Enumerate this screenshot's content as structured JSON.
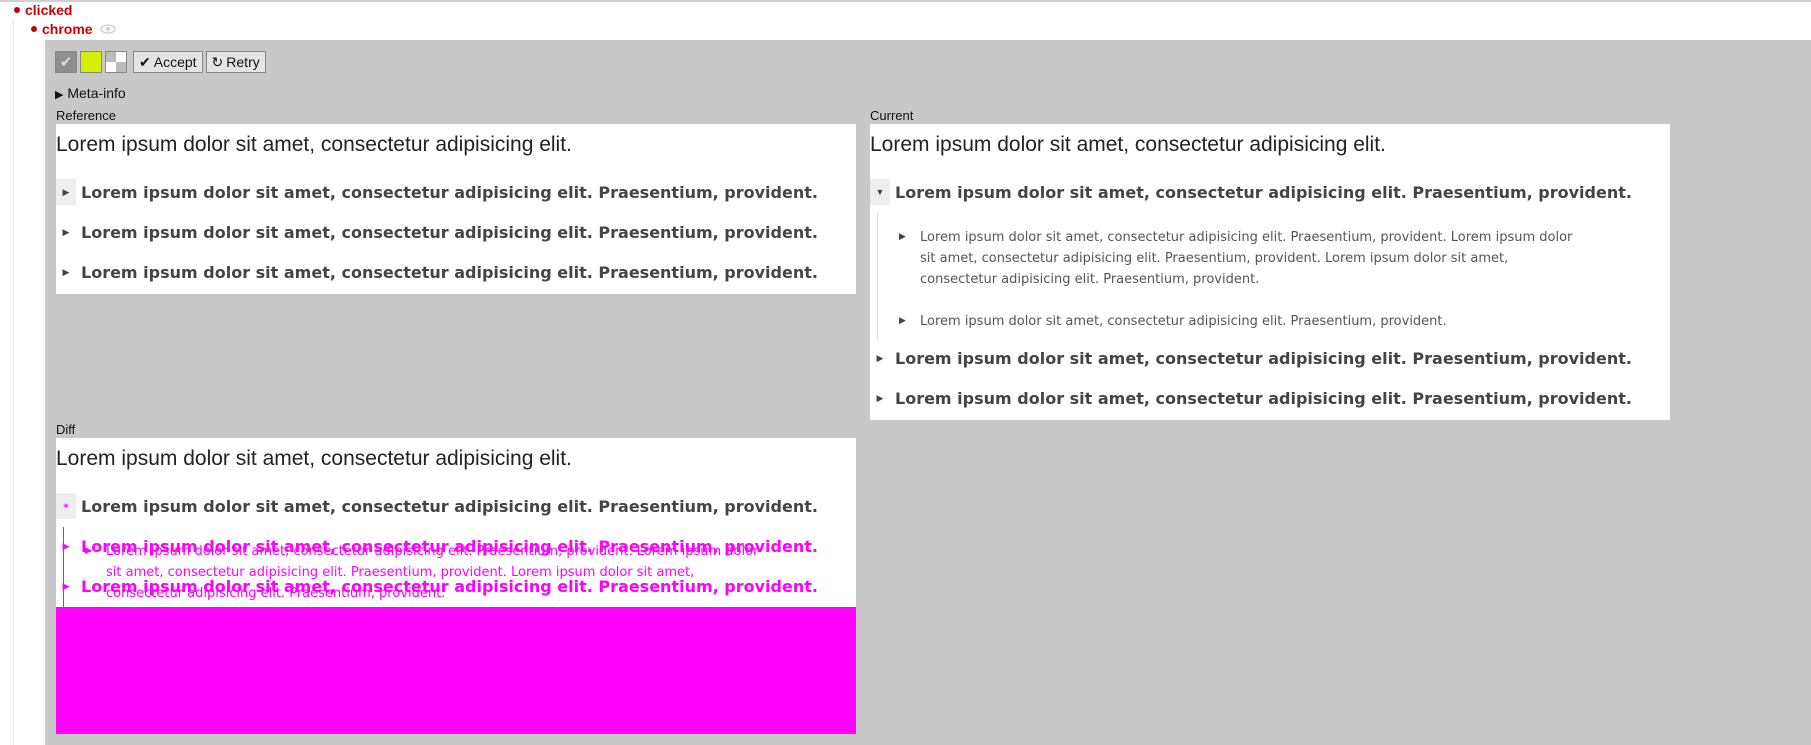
{
  "status": {
    "test_state": "clicked",
    "browser": "chrome"
  },
  "icons": {
    "eye": "eye-icon",
    "check": "check-icon",
    "retry": "retry-icon",
    "triangle_right": "triangle-right-icon",
    "caret_right": "caret-right-icon",
    "caret_down": "caret-down-icon"
  },
  "toolbar": {
    "accept_label": "Accept",
    "retry_label": "Retry",
    "accept_icon": "✔",
    "retry_icon": "↻"
  },
  "meta_info": {
    "label": "Meta-info",
    "arrow": "▶"
  },
  "reference": {
    "label": "Reference",
    "heading": "Lorem ipsum dolor sit amet, consectetur adipisicing elit.",
    "items": [
      "Lorem ipsum dolor sit amet, consectetur adipisicing elit. Praesentium, provident.",
      "Lorem ipsum dolor sit amet, consectetur adipisicing elit. Praesentium, provident.",
      "Lorem ipsum dolor sit amet, consectetur adipisicing elit. Praesentium, provident."
    ]
  },
  "current": {
    "label": "Current",
    "heading": "Lorem ipsum dolor sit amet, consectetur adipisicing elit.",
    "items": [
      "Lorem ipsum dolor sit amet, consectetur adipisicing elit. Praesentium, provident.",
      "Lorem ipsum dolor sit amet, consectetur adipisicing elit. Praesentium, provident.",
      "Lorem ipsum dolor sit amet, consectetur adipisicing elit. Praesentium, provident."
    ],
    "sub_items": [
      "Lorem ipsum dolor sit amet, consectetur adipisicing elit. Praesentium, provident. Lorem ipsum dolor sit amet, consectetur adipisicing elit. Praesentium, provident. Lorem ipsum dolor sit amet, consectetur adipisicing elit. Praesentium, provident.",
      "Lorem ipsum dolor sit amet, consectetur adipisicing elit. Praesentium, provident."
    ]
  },
  "diff": {
    "label": "Diff",
    "heading": "Lorem ipsum dolor sit amet, consectetur adipisicing elit.",
    "item_first": "Lorem ipsum dolor sit amet, consectetur adipisicing elit. Praesentium, provident.",
    "overlay_item_a": "Lorem ipsum dolor sit amet, consectetur adipisicing elit. Praesentium, provident.",
    "overlay_item_b": "Lorem ipsum dolor sit amet, consectetur adipisicing elit. Praesentium, provident.",
    "overlay_sub": "Lorem ipsum dolor sit amet, consectetur adipisicing elit. Praesentium, provident. Lorem ipsum dolor sit amet, consectetur adipisicing elit. Praesentium, provident. Lorem ipsum dolor sit amet, consectetur adipisicing elit. Praesentium, provident.",
    "highlight_color": "#ff00ff"
  },
  "colors": {
    "panel_bg": "#c8c8c8",
    "status_red": "#cc0000",
    "accent_lime": "#d4f000"
  }
}
